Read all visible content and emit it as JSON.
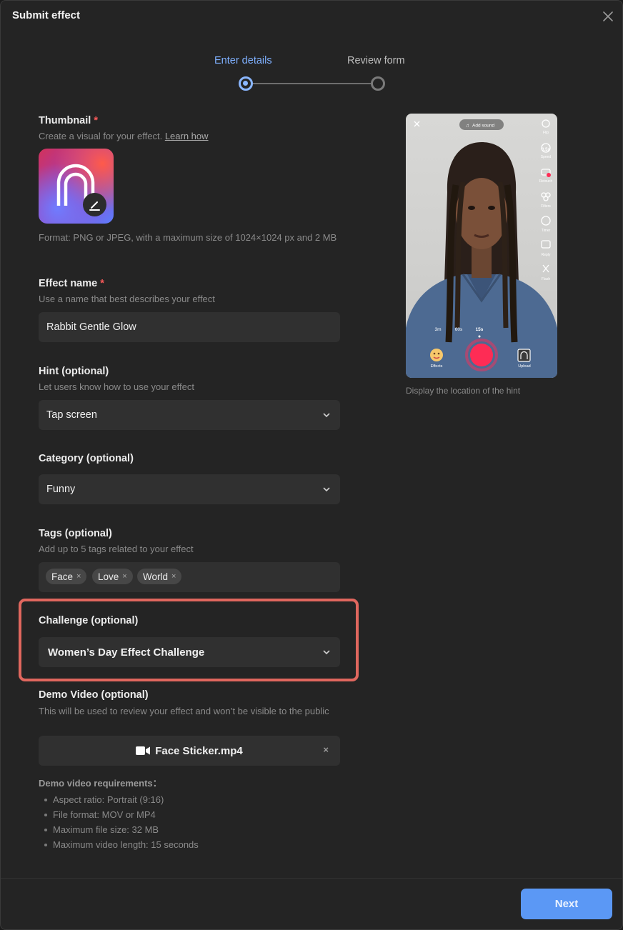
{
  "dialog": {
    "title": "Submit effect"
  },
  "stepper": {
    "step1": "Enter details",
    "step2": "Review form"
  },
  "thumbnail": {
    "label": "Thumbnail",
    "required_mark": "*",
    "description": "Create a visual for your effect.",
    "learn_link": "Learn how",
    "format_note": "Format: PNG or JPEG, with a maximum size of 1024×1024 px and 2 MB"
  },
  "effect_name": {
    "label": "Effect name",
    "required_mark": "*",
    "description": "Use a name that best describes your effect",
    "value": "Rabbit Gentle Glow"
  },
  "hint": {
    "label": "Hint (optional)",
    "description": "Let users know how to use your effect",
    "value": "Tap screen"
  },
  "category": {
    "label": "Category (optional)",
    "value": "Funny"
  },
  "tags": {
    "label": "Tags (optional)",
    "description": "Add up to 5 tags related to your effect",
    "items": [
      "Face",
      "Love",
      "World"
    ],
    "remove_glyph": "×"
  },
  "challenge": {
    "label": "Challenge (optional)",
    "value": "Women’s Day Effect Challenge"
  },
  "demo_video": {
    "label": "Demo Video (optional)",
    "description": "This will be used to review your effect and won’t be visible to the public",
    "file_name": "Face Sticker.mp4",
    "remove_glyph": "×"
  },
  "requirements": {
    "title": "Demo video requirements：",
    "items": [
      "Aspect ratio: Portrait (9:16)",
      "File format: MOV or MP4",
      "Maximum file size: 32 MB",
      "Maximum video length: 15 seconds"
    ]
  },
  "preview": {
    "add_sound": "Add sound",
    "side_tools": [
      "Flip",
      "Speed",
      "Retouch",
      "Filters",
      "Timer",
      "Reply",
      "Flash"
    ],
    "speed_value": "0.5x",
    "durations": [
      "3m",
      "60s",
      "15s"
    ],
    "effects_label": "Effects",
    "upload_label": "Upload",
    "caption": "Display the location of the hint"
  },
  "footer": {
    "next_label": "Next"
  },
  "colors": {
    "accent": "#5b98f5",
    "highlight": "#e0675e",
    "record": "#fe2c55",
    "required": "#ff5a5a"
  }
}
